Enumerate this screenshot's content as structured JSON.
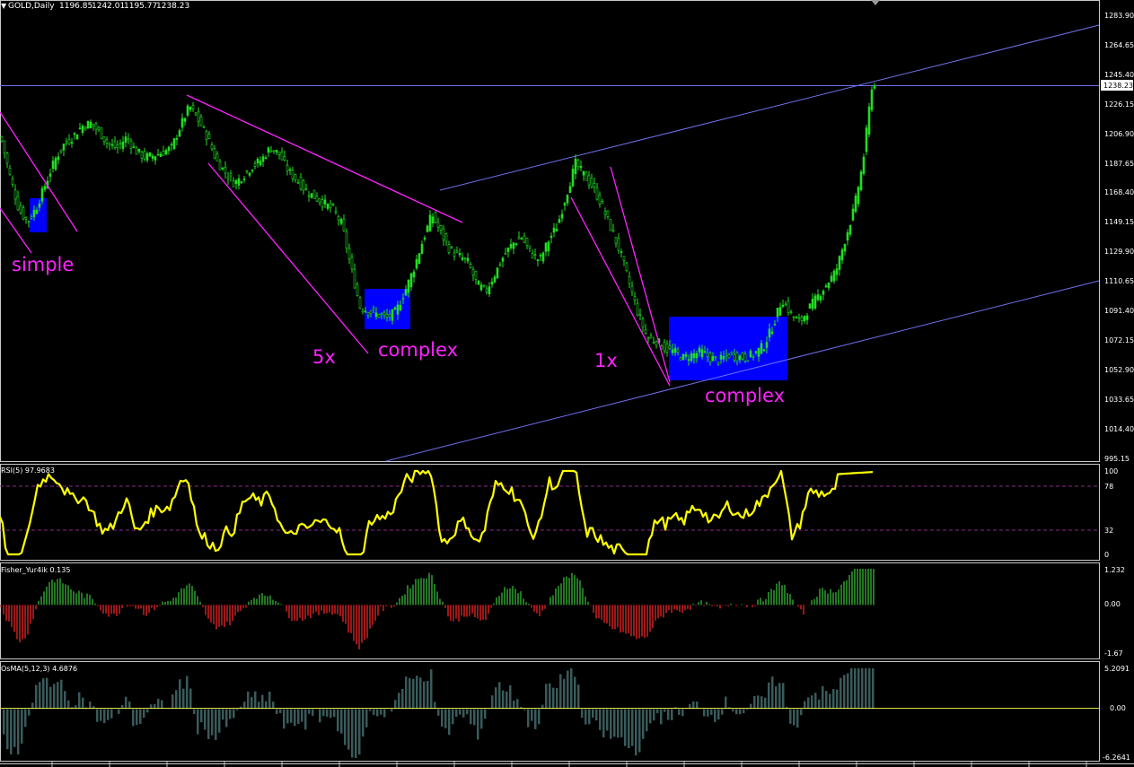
{
  "window": {
    "symbol_title": "GOLD,Daily",
    "ohlc": [
      "1196.85",
      "1242.01",
      "1195.77",
      "1238.23"
    ],
    "current_price": "1238.23"
  },
  "colors": {
    "background": "#000000",
    "candle": "#22dd22",
    "frame": "#c8c8c8",
    "channel": "#7070ee",
    "annotation": "#ff22ff",
    "consolidation_box": "#0000ff",
    "rsi": "#ffff00",
    "rsi_level": "#8a2a8a",
    "fisher_positive": "#33aa33",
    "fisher_negative": "#dd2222",
    "osma": "#3a5a5a",
    "osma_zero": "#dddd44"
  },
  "main_axis": {
    "ticks": [
      "1283.90",
      "1264.65",
      "1245.40",
      "1226.15",
      "1206.90",
      "1187.65",
      "1168.40",
      "1149.15",
      "1129.90",
      "1110.65",
      "1091.40",
      "1072.15",
      "1052.90",
      "1033.65",
      "1014.40",
      "995.15"
    ],
    "range": [
      995.15,
      1283.9
    ]
  },
  "annotations": [
    {
      "text": "simple"
    },
    {
      "text": "5x"
    },
    {
      "text": "complex"
    },
    {
      "text": "1x"
    },
    {
      "text": "complex"
    }
  ],
  "rsi_panel": {
    "label": "RSI(5) 97.9683",
    "ticks": [
      "100",
      "78",
      "32",
      "0"
    ],
    "levels": [
      78,
      32
    ]
  },
  "fisher_panel": {
    "label": "Fisher_Yur4ik 0.135",
    "ticks": [
      "1.232",
      "0.00",
      "-1.67"
    ],
    "range": [
      -1.67,
      1.232
    ]
  },
  "osma_panel": {
    "label": "OsMA(5,12,3) 4.6876",
    "ticks": [
      "5.2091",
      "0.00",
      "-6.2641"
    ],
    "range": [
      -6.2641,
      5.2091
    ]
  },
  "chart_data": {
    "type": "line",
    "title": "GOLD,Daily",
    "ylim": [
      995.15,
      1283.9
    ],
    "series": [
      {
        "name": "GOLD,Daily",
        "x": [
          0,
          10,
          20,
          30,
          40,
          50,
          60,
          70,
          80,
          90,
          100,
          110,
          120,
          130,
          140,
          150,
          160,
          170,
          180,
          190,
          200,
          210,
          220,
          230,
          240,
          250,
          260,
          270,
          280,
          290,
          300,
          310,
          320,
          330,
          340,
          350,
          360,
          370,
          380,
          390,
          400,
          410,
          420,
          430,
          440,
          450,
          460,
          470,
          480,
          490,
          500,
          510,
          520,
          530,
          540,
          550,
          560,
          570,
          580,
          590,
          600,
          610,
          620,
          630,
          640,
          650,
          660,
          670,
          680,
          690,
          700,
          710,
          720,
          730,
          740,
          750,
          760,
          770,
          780,
          790,
          800,
          810,
          820,
          830,
          840,
          850,
          860,
          870,
          880,
          890,
          900,
          910,
          920,
          930,
          940,
          950,
          960,
          970
        ],
        "values": [
          1205,
          1180,
          1158,
          1150,
          1160,
          1175,
          1190,
          1200,
          1205,
          1212,
          1214,
          1208,
          1200,
          1198,
          1205,
          1196,
          1192,
          1193,
          1195,
          1198,
          1212,
          1225,
          1216,
          1205,
          1190,
          1182,
          1175,
          1180,
          1186,
          1190,
          1198,
          1194,
          1183,
          1177,
          1170,
          1166,
          1162,
          1158,
          1148,
          1120,
          1095,
          1092,
          1090,
          1088,
          1092,
          1105,
          1120,
          1138,
          1155,
          1143,
          1132,
          1128,
          1124,
          1110,
          1105,
          1116,
          1128,
          1136,
          1140,
          1130,
          1125,
          1138,
          1148,
          1168,
          1188,
          1180,
          1172,
          1160,
          1145,
          1130,
          1110,
          1090,
          1075,
          1073,
          1068,
          1066,
          1062,
          1064,
          1066,
          1062,
          1060,
          1064,
          1063,
          1062,
          1065,
          1070,
          1083,
          1100,
          1090,
          1085,
          1094,
          1102,
          1110,
          1118,
          1138,
          1158,
          1188,
          1238
        ]
      }
    ]
  }
}
